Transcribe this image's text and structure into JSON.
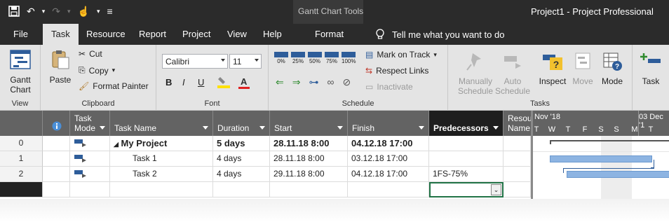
{
  "titlebar": {
    "context_tab_group": "Gantt Chart Tools",
    "app_title": "Project1  -  Project Professional",
    "qat_more": "≡"
  },
  "tabs": [
    "File",
    "Task",
    "Resource",
    "Report",
    "Project",
    "View",
    "Help",
    "Format"
  ],
  "active_tab": "Task",
  "tell_me": "Tell me what you want to do",
  "ribbon": {
    "view": {
      "btn": "Gantt\nChart",
      "label": "View"
    },
    "clipboard": {
      "paste": "Paste",
      "cut": "Cut",
      "copy": "Copy",
      "format_painter": "Format Painter",
      "label": "Clipboard"
    },
    "font": {
      "family": "Calibri",
      "size": "11",
      "bold": "B",
      "italic": "I",
      "underline": "U",
      "font_color": "A",
      "label": "Font"
    },
    "schedule": {
      "percent_buttons": [
        "0%",
        "25%",
        "50%",
        "75%",
        "100%"
      ],
      "mark_on_track": "Mark on Track",
      "respect_links": "Respect Links",
      "inactivate": "Inactivate",
      "label": "Schedule"
    },
    "tasks": {
      "manually_schedule": "Manually Schedule",
      "auto_schedule": "Auto Schedule",
      "inspect": "Inspect",
      "move": "Move",
      "mode": "Mode",
      "label": "Tasks"
    },
    "insert": {
      "task": "Task"
    }
  },
  "grid": {
    "columns": [
      "Task Mode",
      "Task Name",
      "Duration",
      "Start",
      "Finish",
      "Predecessors",
      "Resou Name"
    ],
    "selected_column": "Predecessors",
    "rows": [
      {
        "id": "0",
        "name": "My Project",
        "duration": "5 days",
        "start": "28.11.18 8:00",
        "finish": "04.12.18 17:00",
        "pred": "",
        "summary": true
      },
      {
        "id": "1",
        "name": "Task 1",
        "duration": "4 days",
        "start": "28.11.18 8:00",
        "finish": "03.12.18 17:00",
        "pred": "",
        "summary": false
      },
      {
        "id": "2",
        "name": "Task 2",
        "duration": "4 days",
        "start": "29.11.18 8:00",
        "finish": "04.12.18 17:00",
        "pred": "1FS-75%",
        "summary": false
      }
    ]
  },
  "gantt": {
    "week1": "Nov '18",
    "week2": "03 Dec '1",
    "days": [
      "T",
      "W",
      "T",
      "F",
      "S",
      "S",
      "M",
      "T"
    ]
  }
}
